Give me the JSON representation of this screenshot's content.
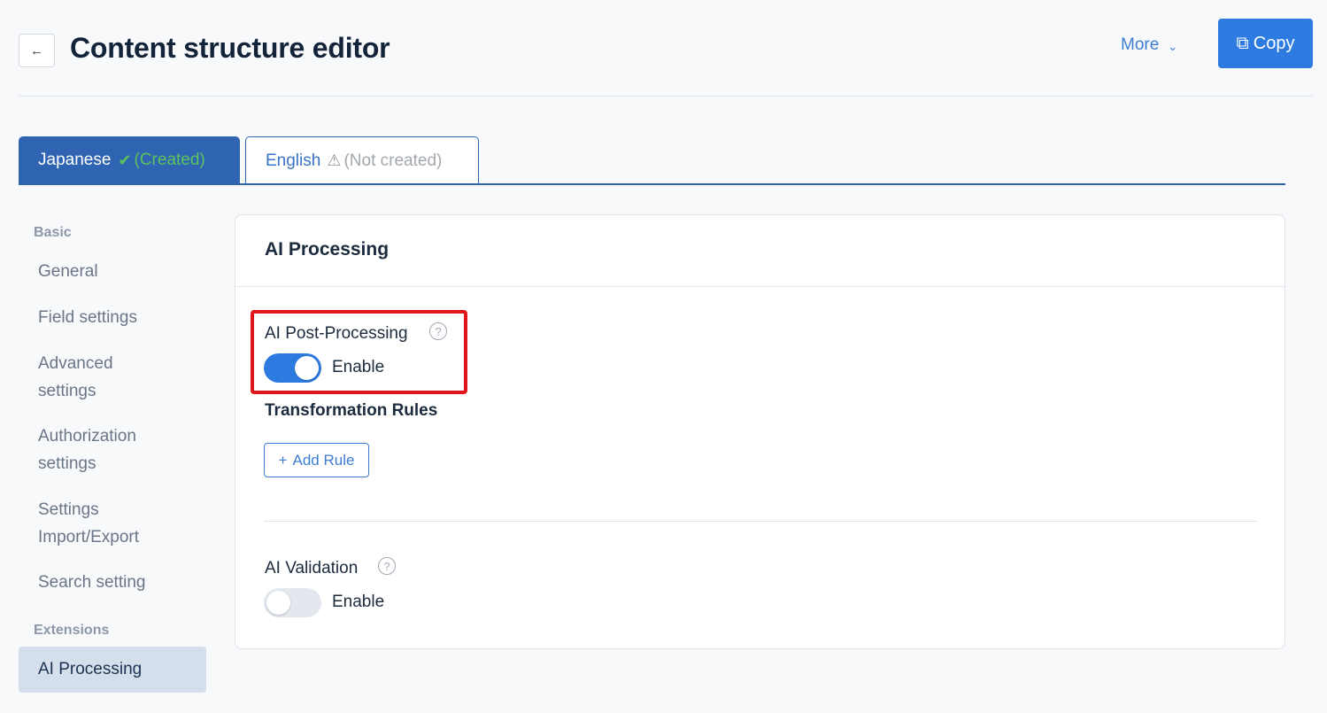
{
  "header": {
    "back_icon": "←",
    "title": "Content structure editor",
    "more_label": "More",
    "more_chevron": "⌄",
    "copy_icon": "⧉",
    "copy_label": "Copy"
  },
  "tabs": [
    {
      "label": "Japanese",
      "status_icon": "✔",
      "status": "(Created)",
      "active": true
    },
    {
      "label": "English",
      "status_icon": "⚠",
      "status": "(Not created)",
      "active": false
    }
  ],
  "sidebar": {
    "groups": [
      {
        "heading": "Basic",
        "items": [
          "General",
          "Field settings",
          "Advanced settings",
          "Authorization settings",
          "Settings Import/Export",
          "Search setting"
        ]
      },
      {
        "heading": "Extensions",
        "items": [
          "AI Processing"
        ]
      }
    ],
    "active_item": "AI Processing"
  },
  "card": {
    "title": "AI Processing",
    "post_processing": {
      "label": "AI Post-Processing",
      "help_icon": "?",
      "toggle_label": "Enable",
      "enabled": true
    },
    "rules": {
      "label": "Transformation Rules",
      "add_icon": "+",
      "add_label": "Add Rule"
    },
    "validation": {
      "label": "AI Validation",
      "help_icon": "?",
      "toggle_label": "Enable",
      "enabled": false
    }
  },
  "colors": {
    "accent": "#2d7be0",
    "tab_active": "#2f64b3",
    "success": "#5cc35c",
    "highlight": "#e0161a"
  }
}
